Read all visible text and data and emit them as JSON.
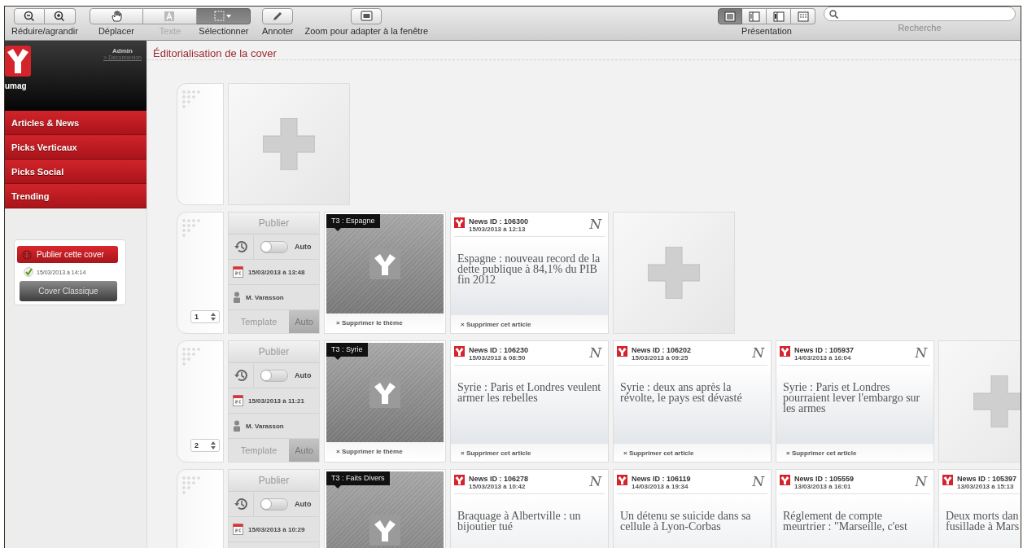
{
  "toolbar": {
    "groups": [
      {
        "label": "Réduire/agrandir",
        "buttons": [
          {
            "selected": false
          },
          {
            "selected": false
          }
        ]
      },
      {
        "buttons": [
          {
            "label": "Déplacer",
            "selected": false,
            "disabled": false
          },
          {
            "label": "Texte",
            "selected": false,
            "disabled": true
          },
          {
            "label": "Sélectionner",
            "selected": true,
            "disabled": false
          }
        ]
      },
      {
        "buttons": [
          {
            "label": "Annoter",
            "selected": false,
            "disabled": false
          }
        ]
      },
      {
        "buttons": [
          {
            "label": "Zoom pour adapter à la fenêtre",
            "selected": false,
            "disabled": false
          }
        ]
      }
    ],
    "view": {
      "label": "Présentation",
      "buttons": [
        {
          "selected": true
        },
        {
          "selected": false
        },
        {
          "selected": false
        },
        {
          "selected": false
        }
      ]
    },
    "search": {
      "label": "Recherche"
    }
  },
  "sidebar": {
    "brand": "umag",
    "user": "Admin",
    "logout": "> Déconnexion",
    "menu": [
      {
        "label": "Articles & News"
      },
      {
        "label": "Picks Verticaux"
      },
      {
        "label": "Picks Social"
      },
      {
        "label": "Trending"
      }
    ],
    "publish": {
      "button": "Publier cette cover",
      "status_date": "15/03/2013 à 14:14",
      "template_button": "Cover Classique"
    }
  },
  "main": {
    "title": "Éditorialisation de la cover",
    "rows": [
      {
        "handle": {},
        "tiles": [
          {
            "kind": "add"
          }
        ]
      },
      {
        "handle": {
          "number": "1"
        },
        "publish": {
          "button": "Publier",
          "disabled": true,
          "auto_label": "Auto",
          "auto_on": false,
          "date": "15/03/2013 à 13:48",
          "author": "M. Varasson",
          "tabs": [
            {
              "label": "Template",
              "selected": false
            },
            {
              "label": "Auto",
              "selected": true
            }
          ]
        },
        "theme": {
          "tag": "T3 : Espagne",
          "remove": "× Supprimer le thème"
        },
        "tiles": [
          {
            "kind": "article",
            "id": "News ID : 106300",
            "date": "15/03/2013 à 12:13",
            "source": "N",
            "title": "Espagne : nouveau record de la dette publique à 84,1% du PIB fin 2012",
            "remove": "× Supprimer cet article"
          },
          {
            "kind": "add"
          }
        ]
      },
      {
        "handle": {
          "number": "2"
        },
        "publish": {
          "button": "Publier",
          "disabled": true,
          "auto_label": "Auto",
          "auto_on": false,
          "date": "15/03/2013 à 11:21",
          "author": "M. Varasson",
          "tabs": [
            {
              "label": "Template",
              "selected": false
            },
            {
              "label": "Auto",
              "selected": true
            }
          ]
        },
        "theme": {
          "tag": "T3 : Syrie",
          "remove": "× Supprimer le thème"
        },
        "tiles": [
          {
            "kind": "article",
            "id": "News ID : 106230",
            "date": "15/03/2013 à 08:50",
            "source": "N",
            "title": "Syrie : Paris et Londres veulent armer les rebelles",
            "remove": "× Supprimer cet article"
          },
          {
            "kind": "article",
            "id": "News ID : 106202",
            "date": "15/03/2013 à 09:25",
            "source": "N",
            "title": "Syrie : deux ans après la révolte, le pays est dévasté",
            "remove": "× Supprimer cet article"
          },
          {
            "kind": "article",
            "id": "News ID : 105937",
            "date": "14/03/2013 à 16:04",
            "source": "N",
            "title": "Syrie : Paris et Londres pourraient lever l'embargo sur les armes",
            "remove": "× Supprimer cet article"
          },
          {
            "kind": "add"
          }
        ]
      },
      {
        "handle": {},
        "publish": {
          "button": "Publier",
          "disabled": true,
          "auto_label": "Auto",
          "auto_on": false,
          "date": "15/03/2013 à 10:29"
        },
        "theme": {
          "tag": "T3 : Faits Divers"
        },
        "tiles": [
          {
            "kind": "article",
            "id": "News ID : 106278",
            "date": "15/03/2013 à 10:42",
            "source": "N",
            "title": "Braquage à Albertville : un bijoutier tué"
          },
          {
            "kind": "article",
            "id": "News ID : 106119",
            "date": "14/03/2013 à 19:34",
            "source": "N",
            "title": "Un détenu se suicide dans sa cellule à Lyon-Corbas"
          },
          {
            "kind": "article",
            "id": "News ID : 105559",
            "date": "13/03/2013 à 16:01",
            "source": "N",
            "title": "Réglement de compte meurtrier : \"Marseille, c'est"
          },
          {
            "kind": "article",
            "id": "News ID : 105397",
            "date": "13/03/2013 à 15:13",
            "title": "Deux morts dan\nfusillade à Mars"
          }
        ]
      }
    ]
  }
}
